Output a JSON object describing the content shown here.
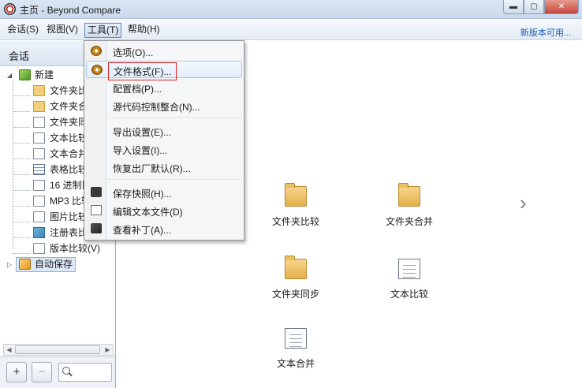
{
  "window": {
    "title": "主页 - Beyond Compare",
    "controls": {
      "minimize": "▬",
      "maximize": "▢",
      "close": "✕"
    }
  },
  "menubar": {
    "items": [
      "会话(S)",
      "视图(V)",
      "工具(T)",
      "帮助(H)"
    ],
    "update_link": "新版本可用..."
  },
  "sidebar": {
    "header": "会话",
    "new_group": "新建",
    "items": [
      "文件夹比较",
      "文件夹合并",
      "文件夹同步",
      "文本比较",
      "文本合并",
      "表格比较",
      "16 进制比较",
      "MP3 比较",
      "图片比较",
      "注册表比较",
      "版本比较(V)"
    ],
    "autosave": "自动保存",
    "add_button": "+",
    "remove_button": "−",
    "search_placeholder": ""
  },
  "tools_menu": {
    "group1": [
      "选项(O)...",
      "文件格式(F)...",
      "配置档(P)...",
      "源代码控制整合(N)..."
    ],
    "group2": [
      "导出设置(E)...",
      "导入设置(I)...",
      "恢复出厂默认(R)..."
    ],
    "group3": [
      "保存快照(H)...",
      "编辑文本文件(D)",
      "查看补丁(A)..."
    ]
  },
  "main": {
    "tiles": [
      "文件夹比较",
      "文件夹合并",
      "文件夹同步",
      "文本比较",
      "文本合并"
    ],
    "next_arrow": "›"
  }
}
